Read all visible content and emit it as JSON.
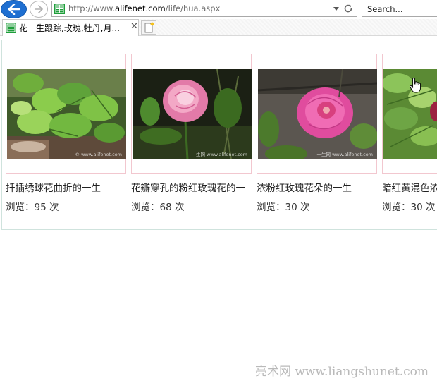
{
  "browser": {
    "url_prefix": "http://www.",
    "url_domain": "alifenet.com",
    "url_path": "/life/hua.aspx",
    "search_placeholder": "Search...",
    "active_tab_title": "花一生跟踪,玫瑰,牡丹,月...",
    "tab_close_glyph": "✕"
  },
  "gallery": {
    "items": [
      {
        "title": "扦插绣球花曲折的一生",
        "views_label": "浏览：",
        "views": "95",
        "views_unit": "次",
        "photo_watermark": "© www.alifenet.com"
      },
      {
        "title": "花瓣穿孔的粉红玫瑰花的一",
        "views_label": "浏览：",
        "views": "68",
        "views_unit": "次",
        "photo_watermark": "生网 www.alifenet.com"
      },
      {
        "title": "浓粉红玫瑰花朵的一生",
        "views_label": "浏览：",
        "views": "30",
        "views_unit": "次",
        "photo_watermark": "一生网 www.alifenet.com"
      },
      {
        "title": "暗红黄混色浓",
        "views_label": "浏览：",
        "views": "30",
        "views_unit": "次",
        "photo_watermark": ""
      }
    ]
  },
  "watermark": "亮术网 www.liangshunet.com",
  "colors": {
    "card_border": "#f2c7cf",
    "frame_border": "#cfe3dd",
    "back_button": "#1f6fd1"
  }
}
